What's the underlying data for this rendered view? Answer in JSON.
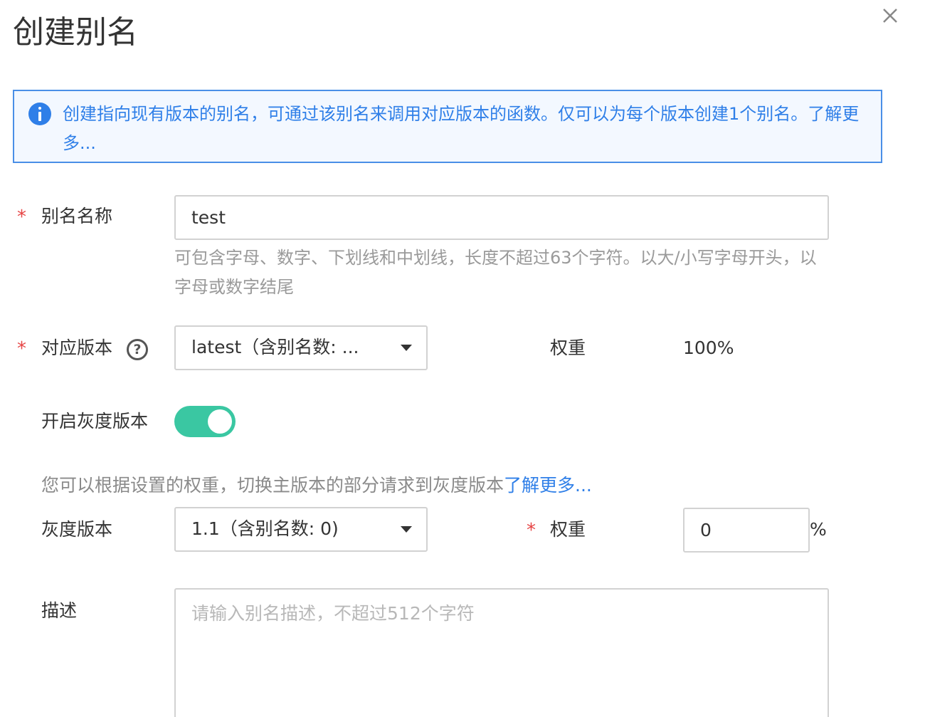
{
  "dialog": {
    "title": "创建别名",
    "close_icon": "close-icon"
  },
  "banner": {
    "icon": "info-icon",
    "text": "创建指向现有版本的别名，可通过该别名来调用对应版本的函数。仅可以为每个版本创建1个别名。",
    "link": "了解更多..."
  },
  "alias_name": {
    "label": "别名名称",
    "required_mark": "*",
    "value": "test",
    "hint": "可包含字母、数字、下划线和中划线，长度不超过63个字符。以大/小写字母开头，以字母或数字结尾"
  },
  "version": {
    "label": "对应版本",
    "required_mark": "*",
    "help_icon": "question-circle-icon",
    "help_glyph": "?",
    "selected": "latest（含别名数: ...",
    "weight_label": "权重",
    "weight_value": "100%"
  },
  "gray_toggle": {
    "label": "开启灰度版本",
    "enabled": true,
    "accent_color": "#3ac7a2"
  },
  "gray_note": {
    "text": "您可以根据设置的权重，切换主版本的部分请求到灰度版本",
    "link": "了解更多..."
  },
  "gray_version": {
    "label": "灰度版本",
    "selected": "1.1（含别名数: 0)",
    "weight_label": "权重",
    "required_mark": "*",
    "weight_value": "0",
    "unit": "%"
  },
  "description": {
    "label": "描述",
    "placeholder": "请输入别名描述，不超过512个字符"
  }
}
